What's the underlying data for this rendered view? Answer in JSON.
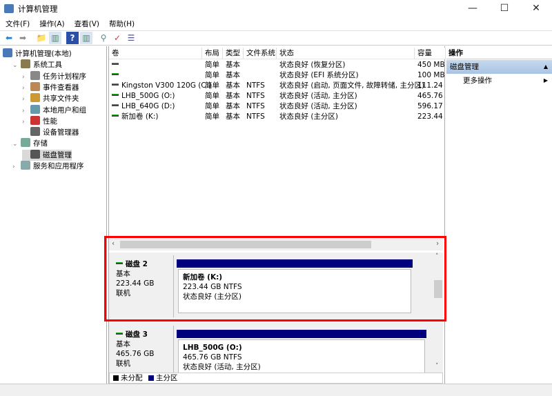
{
  "window": {
    "title": "计算机管理",
    "minimize": "—",
    "maximize": "☐",
    "close": "✕"
  },
  "menu": [
    "文件(F)",
    "操作(A)",
    "查看(V)",
    "帮助(H)"
  ],
  "toolbar": [
    "back-icon",
    "forward-icon",
    "up-icon",
    "show-hide-tree-icon",
    "help-icon",
    "show-hide-action-icon",
    "connect-icon",
    "properties-icon",
    "list-icon"
  ],
  "tree": [
    {
      "label": "计算机管理(本地)",
      "level": 0,
      "exp": ""
    },
    {
      "label": "系统工具",
      "level": 1,
      "exp": "⌄"
    },
    {
      "label": "任务计划程序",
      "level": 2,
      "exp": "›"
    },
    {
      "label": "事件查看器",
      "level": 2,
      "exp": "›"
    },
    {
      "label": "共享文件夹",
      "level": 2,
      "exp": "›"
    },
    {
      "label": "本地用户和组",
      "level": 2,
      "exp": "›"
    },
    {
      "label": "性能",
      "level": 2,
      "exp": "›"
    },
    {
      "label": "设备管理器",
      "level": 2,
      "exp": ""
    },
    {
      "label": "存储",
      "level": 1,
      "exp": "⌄"
    },
    {
      "label": "磁盘管理",
      "level": 2,
      "exp": "",
      "selected": true
    },
    {
      "label": "服务和应用程序",
      "level": 1,
      "exp": "›"
    }
  ],
  "table": {
    "columns": [
      "卷",
      "布局",
      "类型",
      "文件系统",
      "状态",
      "容量"
    ],
    "rows": [
      [
        "",
        "简单",
        "基本",
        "",
        "状态良好 (恢复分区)",
        "450 MB"
      ],
      [
        "",
        "简单",
        "基本",
        "",
        "状态良好 (EFI 系统分区)",
        "100 MB"
      ],
      [
        "Kingston V300 120G (C:)",
        "简单",
        "基本",
        "NTFS",
        "状态良好 (启动, 页面文件, 故障转储, 主分区)",
        "111.24"
      ],
      [
        "LHB_500G (O:)",
        "简单",
        "基本",
        "NTFS",
        "状态良好 (活动, 主分区)",
        "465.76"
      ],
      [
        "LHB_640G (D:)",
        "简单",
        "基本",
        "NTFS",
        "状态良好 (活动, 主分区)",
        "596.17"
      ],
      [
        "新加卷 (K:)",
        "简单",
        "基本",
        "NTFS",
        "状态良好 (主分区)",
        "223.44"
      ]
    ]
  },
  "disks": [
    {
      "name": "磁盘 2",
      "type": "基本",
      "size": "223.44 GB",
      "status": "联机",
      "partition": {
        "title": "新加卷  (K:)",
        "size": "223.44 GB NTFS",
        "status": "状态良好 (主分区)"
      }
    },
    {
      "name": "磁盘 3",
      "type": "基本",
      "size": "465.76 GB",
      "status": "联机",
      "partition": {
        "title": "LHB_500G  (O:)",
        "size": "465.76 GB NTFS",
        "status": "状态良好 (活动, 主分区)"
      }
    }
  ],
  "legend": [
    {
      "label": "未分配",
      "color": "#000000"
    },
    {
      "label": "主分区",
      "color": "#00007f"
    }
  ],
  "actions": {
    "header": "操作",
    "section": "磁盘管理",
    "item": "更多操作"
  },
  "colors": {
    "primary_partition": "#00007f",
    "highlight": "#ff0000"
  }
}
